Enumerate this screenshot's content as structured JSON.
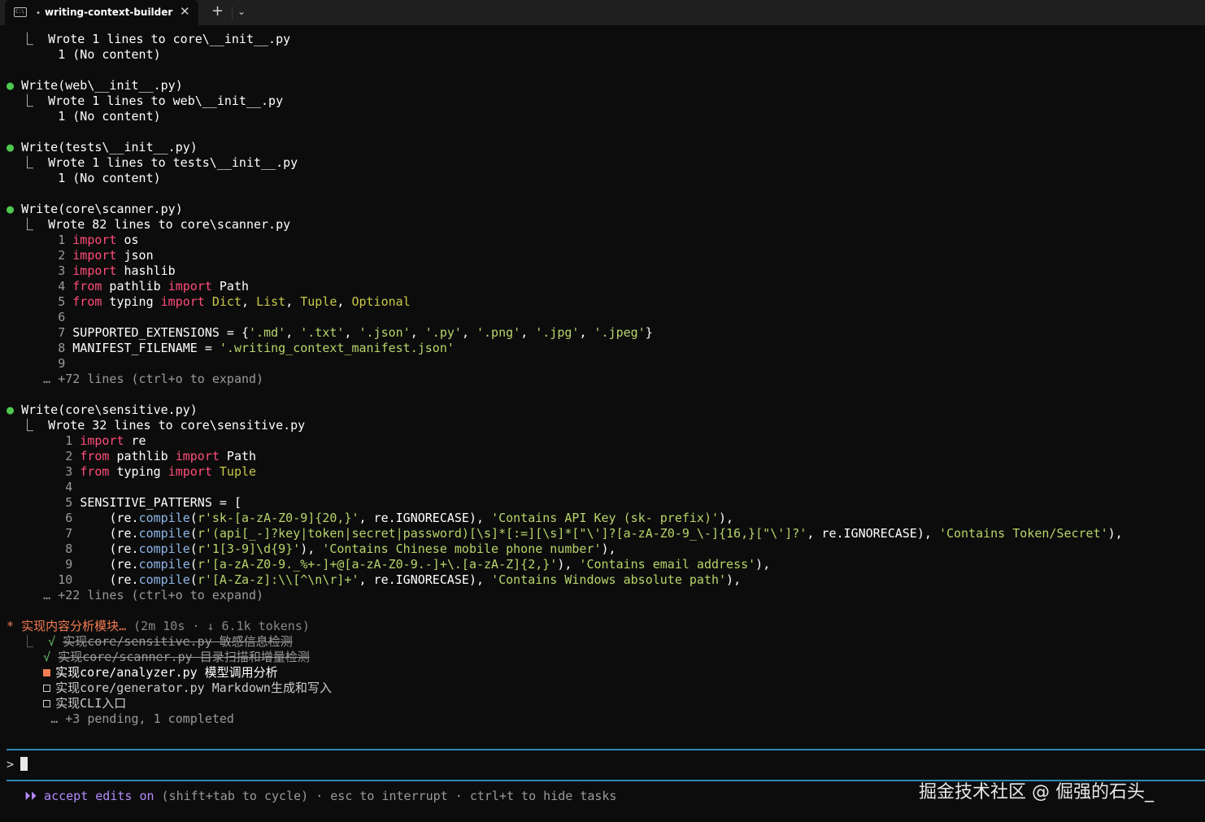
{
  "window": {
    "tab_title": "writing-context-builder",
    "tab_icon": "terminal-icon",
    "tab_icon_text": "C:\\",
    "tab_dot": "•",
    "close_symbol": "✕",
    "new_tab_symbol": "+",
    "dropdown_symbol": "⌄"
  },
  "log": {
    "l1": "  ⎿  Wrote 1 lines to core\\__init__.py",
    "l2": "       1 (No content)",
    "l3": "Write(web\\__init__.py)",
    "l4": "  ⎿  Wrote 1 lines to web\\__init__.py",
    "l5": "       1 (No content)",
    "l6": "Write(tests\\__init__.py)",
    "l7": "  ⎿  Wrote 1 lines to tests\\__init__.py",
    "l8": "       1 (No content)",
    "l9": "Write(core\\scanner.py)",
    "l10": "  ⎿  Wrote 82 lines to core\\scanner.py",
    "s1": "import",
    "s1b": " os",
    "s2b": " json",
    "s3b": " hashlib",
    "s4a": "from",
    "s4b": " pathlib ",
    "s4c": "import",
    "s4d": " Path",
    "s5b": " typing ",
    "s5d": "Dict",
    "s5e": "List",
    "s5f": "Tuple",
    "s5g": "Optional",
    "s7a": "SUPPORTED_EXTENSIONS = {",
    "s7b": "'.md'",
    "s7c": "'.txt'",
    "s7d": "'.json'",
    "s7e": "'.py'",
    "s7f": "'.png'",
    "s7g": "'.jpg'",
    "s7h": "'.jpeg'",
    "s8a": "MANIFEST_FILENAME = ",
    "s8b": "'.writing_context_manifest.json'",
    "s_expand": "     … +72 lines (ctrl+o to expand)",
    "l11": "Write(core\\sensitive.py)",
    "l12": "  ⎿  Wrote 32 lines to core\\sensitive.py",
    "t1b": " re",
    "t2b": " pathlib ",
    "t2d": " Path",
    "t3b": " typing ",
    "t3d": " Tuple",
    "t5": "SENSITIVE_PATTERNS = [",
    "p6a": "r'sk-[a-zA-Z0-9]{20,}'",
    "p6b": ", re.IGNORECASE), ",
    "p6c": "'Contains API Key (sk- prefix)'",
    "p7a": "r'(api[_-]?key|token|secret|password)[\\s]*[:=][\\s]*[\"\\']?[a-zA-Z0-9_\\-]{16,}[\"\\']?'",
    "p7b": ", re.IGNORECASE), ",
    "p7c": "'Contains Token/Secret'",
    "p8a": "r'1[3-9]\\d{9}'",
    "p8c": "'Contains Chinese mobile phone number'",
    "p9a": "r'[a-zA-Z0-9._%+-]+@[a-zA-Z0-9.-]+\\.[a-zA-Z]{2,}'",
    "p9c": "'Contains email address'",
    "p10a": "r'[A-Za-z]:\\\\[^\\n\\r]+'",
    "p10b": ", re.IGNORECASE), ",
    "p10c": "'Contains Windows absolute path'",
    "t_expand": "     … +22 lines (ctrl+o to expand)",
    "paren_re": "(re.",
    "compile": "compile",
    "close_tail": "),",
    "comma": ", ",
    "close_brace": "}"
  },
  "task": {
    "star": "* ",
    "title": "实现内容分析模块…",
    "meta": " (2m 10s · ↓ 6.1k tokens)",
    "items": [
      {
        "text": "实现core/sensitive.py 敏感信息检测",
        "status": "done"
      },
      {
        "text": "实现core/scanner.py 目录扫描和增量检测",
        "status": "done"
      },
      {
        "text": "实现core/analyzer.py 模型调用分析",
        "status": "in_progress"
      },
      {
        "text": "实现core/generator.py Markdown生成和写入",
        "status": "pending"
      },
      {
        "text": "实现CLI入口",
        "status": "pending"
      }
    ],
    "more": "+3 pending, 1 completed",
    "branch": "⎿",
    "check_mark": "√",
    "more_prefix": "…"
  },
  "prompt": {
    "symbol": ">"
  },
  "status": {
    "icon": "⏵⏵",
    "accept": "accept edits on",
    "rest": " (shift+tab to cycle) · esc to interrupt · ctrl+t to hide tasks"
  },
  "watermark": "掘金技术社区 @ 倔强的石头_",
  "colors": {
    "background": "#0c0c0c",
    "keyword": "#ff4d7a",
    "type": "#c8c84a",
    "string": "#b8d56a",
    "bullet": "#4ec94e",
    "task_accent": "#f47c52",
    "mode_accent": "#b48cff",
    "prompt_border": "#2c8ab0"
  },
  "line_numbers": [
    "1",
    "2",
    "3",
    "4",
    "5",
    "6",
    "7",
    "8",
    "9",
    "10"
  ]
}
